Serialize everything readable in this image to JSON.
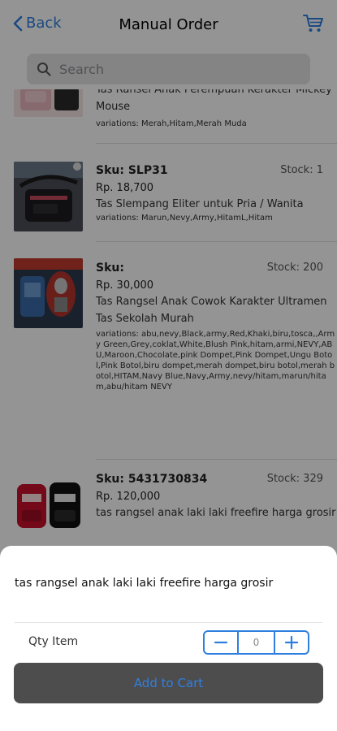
{
  "nav": {
    "back_label": "Back",
    "title": "Manual Order"
  },
  "search": {
    "placeholder": "Search"
  },
  "products": [
    {
      "name": "Tas Ransel Anak Perempuan Kerakter Mickey Mouse",
      "variations": "variations: Merah,Hitam,Merah Muda"
    },
    {
      "sku": "Sku: SLP31",
      "stock": "Stock: 1",
      "price": "Rp. 18,700",
      "name": "Tas Slempang Eliter untuk Pria / Wanita",
      "variations": "variations: Marun,Nevy,Army,HitamL,Hitam"
    },
    {
      "sku": "Sku:",
      "stock": "Stock: 200",
      "price": "Rp. 30,000",
      "name": "Tas Rangsel Anak Cowok Karakter Ultramen Tas Sekolah Murah",
      "variations": "variations: abu,nevy,Black,army,Red,Khaki,biru,tosca,,Army Green,Grey,coklat,White,Blush Pink,hitam,armi,NEVY,ABU,Maroon,Chocolate,pink Dompet,Pink Dompet,Ungu Botol,Pink Botol,biru dompet,merah dompet,biru botol,merah botol,HITAM,Navy Blue,Navy,Army,nevy/hitam,marun/hitam,abu/hitam NEVY"
    },
    {
      "sku": "Sku: 5431730834",
      "stock": "Stock: 329",
      "price": "Rp. 120,000",
      "name": "tas rangsel anak laki laki freefire harga grosir"
    }
  ],
  "sheet": {
    "product_name": "tas rangsel anak laki laki freefire harga grosir",
    "qty_label": "Qty Item",
    "qty_value": "0",
    "add_button": "Add to Cart"
  },
  "colors": {
    "accent": "#2f7fe0",
    "overlay": "rgba(0,0,0,0.42)",
    "button_bg": "#4d4d4d"
  },
  "icons": [
    "chevron-left-icon",
    "cart-icon",
    "search-icon",
    "minus-icon",
    "plus-icon"
  ]
}
